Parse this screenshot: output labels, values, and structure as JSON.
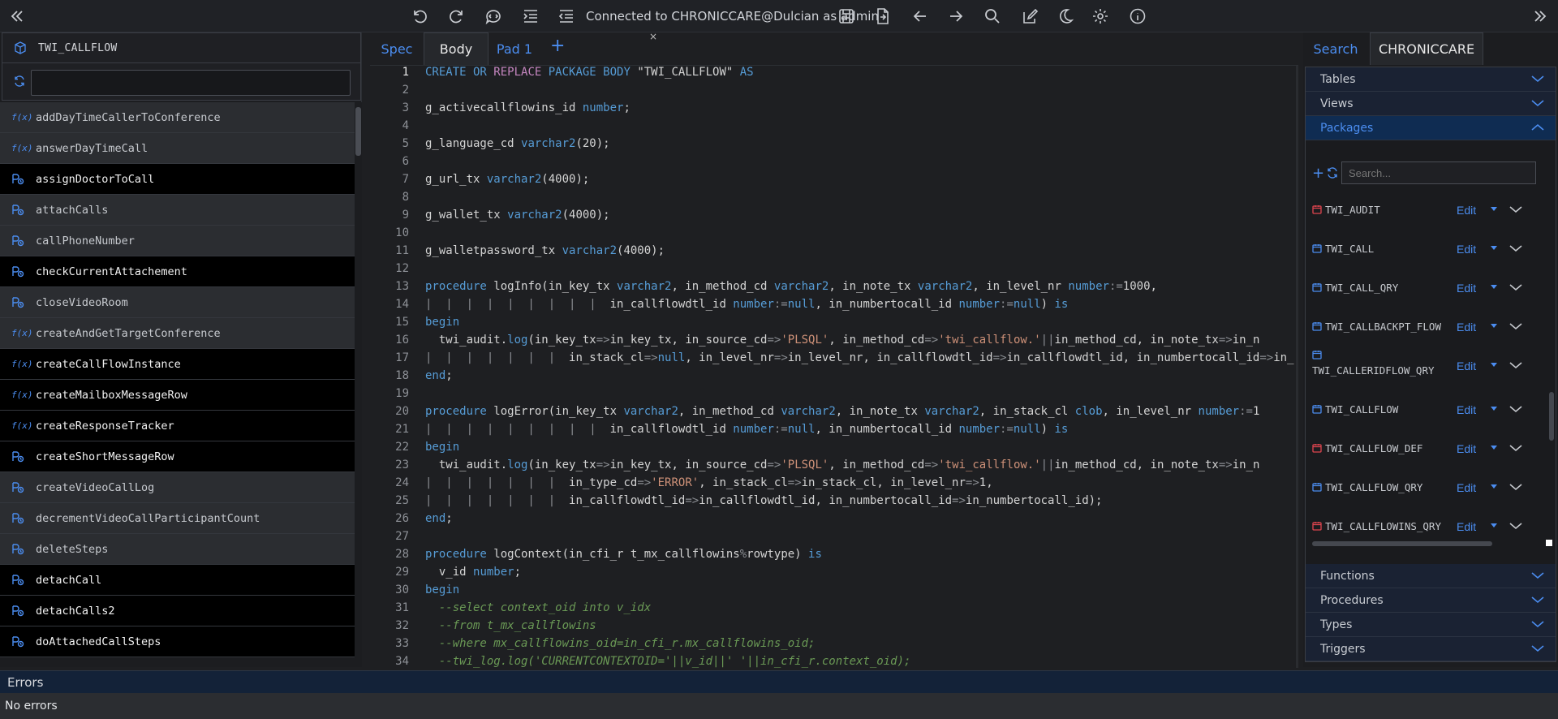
{
  "toolbar": {
    "connection_status": "Connected to CHRONICCARE@Dulcian as admin"
  },
  "left_panel": {
    "package_name": "TWI_CALLFLOW",
    "filter_placeholder": "",
    "members": [
      {
        "name": "addDayTimeCallerToConference",
        "kind": "function",
        "style": "light"
      },
      {
        "name": "answerDayTimeCall",
        "kind": "function",
        "style": "light"
      },
      {
        "name": "assignDoctorToCall",
        "kind": "procedure",
        "style": "dark"
      },
      {
        "name": "attachCalls",
        "kind": "procedure",
        "style": "light"
      },
      {
        "name": "callPhoneNumber",
        "kind": "procedure",
        "style": "light"
      },
      {
        "name": "checkCurrentAttachement",
        "kind": "procedure",
        "style": "dark"
      },
      {
        "name": "closeVideoRoom",
        "kind": "procedure",
        "style": "light"
      },
      {
        "name": "createAndGetTargetConference",
        "kind": "function",
        "style": "light"
      },
      {
        "name": "createCallFlowInstance",
        "kind": "function",
        "style": "dark"
      },
      {
        "name": "createMailboxMessageRow",
        "kind": "function",
        "style": "dark"
      },
      {
        "name": "createResponseTracker",
        "kind": "function",
        "style": "dark"
      },
      {
        "name": "createShortMessageRow",
        "kind": "procedure",
        "style": "dark"
      },
      {
        "name": "createVideoCallLog",
        "kind": "procedure",
        "style": "light"
      },
      {
        "name": "decrementVideoCallParticipantCount",
        "kind": "procedure",
        "style": "light"
      },
      {
        "name": "deleteSteps",
        "kind": "procedure",
        "style": "light"
      },
      {
        "name": "detachCall",
        "kind": "procedure",
        "style": "dark"
      },
      {
        "name": "detachCalls2",
        "kind": "procedure",
        "style": "dark"
      },
      {
        "name": "doAttachedCallSteps",
        "kind": "procedure",
        "style": "dark"
      }
    ]
  },
  "editor": {
    "tabs": {
      "spec": "Spec",
      "body": "Body",
      "pad": "Pad 1",
      "close": "×",
      "add": "+"
    },
    "lines": [
      "1",
      "2",
      "3",
      "4",
      "5",
      "6",
      "7",
      "8",
      "9",
      "10",
      "11",
      "12",
      "13",
      "14",
      "15",
      "16",
      "17",
      "18",
      "19",
      "20",
      "21",
      "22",
      "23",
      "24",
      "25",
      "26",
      "27",
      "28",
      "29",
      "30",
      "31",
      "32",
      "33",
      "34"
    ]
  },
  "right_panel": {
    "tab_search": "Search",
    "tab_db": "CHRONICCARE",
    "sections": {
      "tables": "Tables",
      "views": "Views",
      "packages": "Packages",
      "functions": "Functions",
      "procedures": "Procedures",
      "types": "Types",
      "triggers": "Triggers"
    },
    "package_search_placeholder": "Search...",
    "edit_label": "Edit",
    "packages": [
      {
        "name": "TWI_AUDIT",
        "icon_color": "#e0454f"
      },
      {
        "name": "TWI_CALL",
        "icon_color": "#4b8df0"
      },
      {
        "name": "TWI_CALL_QRY",
        "icon_color": "#4b8df0"
      },
      {
        "name": "TWI_CALLBACKPT_FLOW",
        "icon_color": "#4b8df0"
      },
      {
        "name": "TWI_CALLERIDFLOW_QRY",
        "icon_color": "#4b8df0"
      },
      {
        "name": "TWI_CALLFLOW",
        "icon_color": "#4b8df0"
      },
      {
        "name": "TWI_CALLFLOW_DEF",
        "icon_color": "#e0454f"
      },
      {
        "name": "TWI_CALLFLOW_QRY",
        "icon_color": "#4b8df0"
      },
      {
        "name": "TWI_CALLFLOWINS_QRY",
        "icon_color": "#e0454f"
      }
    ]
  },
  "errors": {
    "title": "Errors",
    "message": "No errors"
  },
  "colors": {
    "accent": "#4b8df0",
    "keyword": "#569cd6",
    "string": "#ce9178",
    "comment": "#6a9955",
    "replace_kw": "#c586c0"
  }
}
